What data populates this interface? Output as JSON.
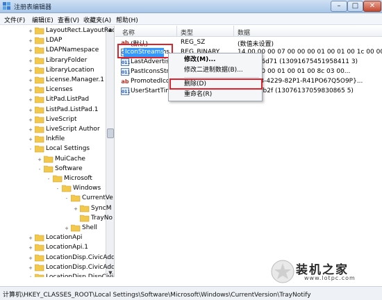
{
  "window": {
    "title": "注册表编辑器"
  },
  "menu": [
    "文件(F)",
    "编辑(E)",
    "查看(V)",
    "收藏夹(A)",
    "帮助(H)"
  ],
  "tree": [
    {
      "label": "LayoutRect.LayoutRect.",
      "level": 0,
      "expander": "+"
    },
    {
      "label": "LDAP",
      "level": 0,
      "expander": "+"
    },
    {
      "label": "LDAPNamespace",
      "level": 0,
      "expander": "+"
    },
    {
      "label": "LibraryFolder",
      "level": 0,
      "expander": "+"
    },
    {
      "label": "LibraryLocation",
      "level": 0,
      "expander": "+"
    },
    {
      "label": "License.Manager.1",
      "level": 0,
      "expander": "+"
    },
    {
      "label": "Licenses",
      "level": 0,
      "expander": "+"
    },
    {
      "label": "LitPad.ListPad",
      "level": 0,
      "expander": "+"
    },
    {
      "label": "ListPad.ListPad.1",
      "level": 0,
      "expander": "+"
    },
    {
      "label": "LiveScript",
      "level": 0,
      "expander": "+"
    },
    {
      "label": "LiveScript Author",
      "level": 0,
      "expander": "+"
    },
    {
      "label": "lnkfile",
      "level": 0,
      "expander": "+"
    },
    {
      "label": "Local Settings",
      "level": 0,
      "expander": "-"
    },
    {
      "label": "MuiCache",
      "level": 1,
      "expander": "+"
    },
    {
      "label": "Software",
      "level": 1,
      "expander": "-"
    },
    {
      "label": "Microsoft",
      "level": 2,
      "expander": "-"
    },
    {
      "label": "Windows",
      "level": 3,
      "expander": "-"
    },
    {
      "label": "CurrentVe",
      "level": 4,
      "expander": "-"
    },
    {
      "label": "SyncM",
      "level": 5,
      "expander": "+"
    },
    {
      "label": "TrayNo",
      "level": 5,
      "expander": ""
    },
    {
      "label": "Shell",
      "level": 4,
      "expander": "+"
    },
    {
      "label": "LocationApi",
      "level": 0,
      "expander": "+"
    },
    {
      "label": "LocationApi.1",
      "level": 0,
      "expander": "+"
    },
    {
      "label": "LocationDisp.CivicAddr",
      "level": 0,
      "expander": "+"
    },
    {
      "label": "LocationDisp.CivicAddr",
      "level": 0,
      "expander": "+"
    },
    {
      "label": "LocationDisp.DispCivic",
      "level": 0,
      "expander": "+"
    }
  ],
  "list": {
    "headers": {
      "name": "名称",
      "type": "类型",
      "data": "数据"
    },
    "rows": [
      {
        "icon": "ab",
        "kind": "str",
        "name": "(默认)",
        "type": "REG_SZ",
        "data": "(数值未设置)"
      },
      {
        "icon": "011",
        "kind": "bin",
        "name": "IconStreams",
        "type": "REG_BINARY",
        "data": "14 00 00 00 07 00 00 00 01 00 01 00 1c 00 00..."
      },
      {
        "icon": "011",
        "kind": "bin",
        "name": "LastAdvertise",
        "type": "",
        "data": "1838496d71 (13091675451958411 3)"
      },
      {
        "icon": "011",
        "kind": "bin",
        "name": "PastIconsStre",
        "type": "",
        "data": "05 00 00 00 01 00 01 00 8c 03 00..."
      },
      {
        "icon": "ab",
        "kind": "str",
        "name": "PromotedIco",
        "type": "",
        "data": "76-23R3-4229-82P1-R41PO67Q5O9P}..."
      },
      {
        "icon": "011",
        "kind": "bin",
        "name": "UserStartTim",
        "type": "",
        "data": "c614dafb2f (13076137059830865 5)"
      }
    ]
  },
  "context_menu": {
    "items": [
      {
        "label": "修改(M)...",
        "bold": true
      },
      {
        "label": "修改二进制数据(B)...",
        "bold": false
      },
      {
        "label": "删除(D)",
        "bold": false
      },
      {
        "label": "重命名(R)",
        "bold": false
      }
    ]
  },
  "status": {
    "path": "计算机\\HKEY_CLASSES_ROOT\\Local Settings\\Software\\Microsoft\\Windows\\CurrentVersion\\TrayNotify"
  },
  "watermark": {
    "text": "装机之家",
    "url": "www.lotpc.com"
  },
  "colors": {
    "selection": "#3399ff",
    "highlight_box": "#e0202a",
    "folder": "#f2c94c"
  }
}
